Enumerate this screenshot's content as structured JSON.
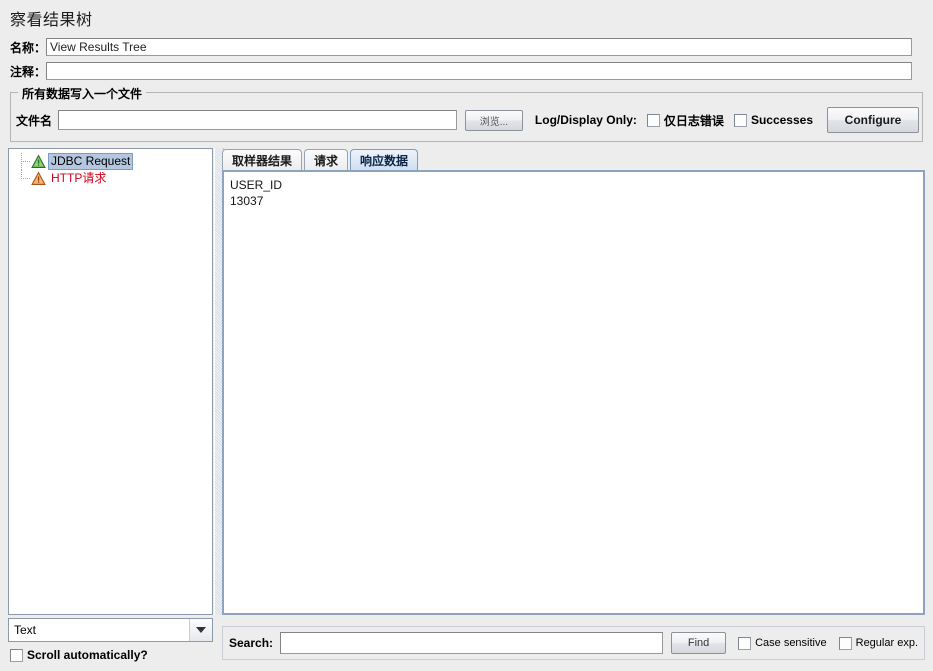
{
  "window": {
    "title": "察看结果树"
  },
  "form": {
    "name_label": "名称：",
    "name_value": "View Results Tree",
    "comment_label": "注释：",
    "comment_value": ""
  },
  "file_group": {
    "legend": "所有数据写入一个文件",
    "filename_label": "文件名",
    "filename_value": "",
    "filename_placeholder": "",
    "browse_label": "浏览...",
    "log_display_label": "Log/Display Only:",
    "checkboxes": [
      {
        "label": "仅日志错误",
        "checked": false
      },
      {
        "label": "Successes",
        "checked": false
      }
    ],
    "configure_label": "Configure"
  },
  "tree": {
    "items": [
      {
        "label": "JDBC Request",
        "icon": "triangle-success-icon",
        "status": "success",
        "selected": true
      },
      {
        "label": "HTTP请求",
        "icon": "triangle-error-icon",
        "status": "error",
        "selected": false
      }
    ]
  },
  "render_select": {
    "value": "Text",
    "arrow_icon": "chevron-down-icon"
  },
  "scroll_auto": {
    "label": "Scroll automatically?",
    "checked": false
  },
  "tabs": [
    {
      "label": "取样器结果",
      "active": false
    },
    {
      "label": "请求",
      "active": false
    },
    {
      "label": "响应数据",
      "active": true
    }
  ],
  "response": {
    "lines": [
      "USER_ID",
      "13037"
    ]
  },
  "search": {
    "label": "Search:",
    "value": "",
    "placeholder": "",
    "find_label": "Find",
    "case_sensitive": {
      "label": "Case sensitive",
      "checked": false
    },
    "regular_exp": {
      "label": "Regular exp.",
      "checked": false
    }
  },
  "colors": {
    "background": "#ededed",
    "selection": "#b5c7e0",
    "error_text": "#d0021b",
    "success_icon": "#4a9a3f",
    "error_icon": "#e07a1f",
    "panel_border": "#8e9aa8",
    "active_tab": "#cfe0f2"
  }
}
